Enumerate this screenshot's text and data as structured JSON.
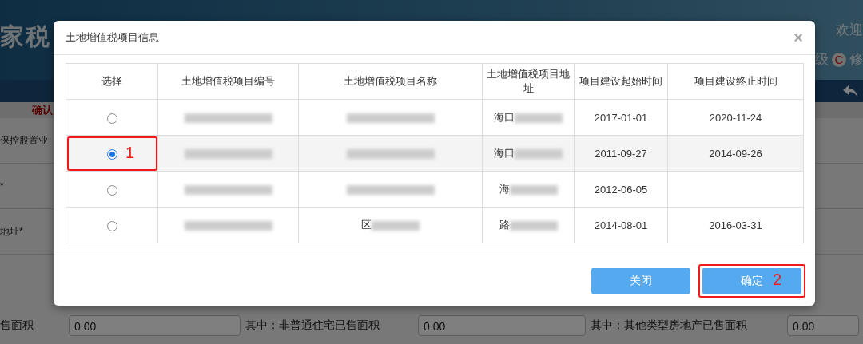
{
  "background": {
    "header_title": "家税",
    "welcome": "欢迎",
    "level_label": "级",
    "level_badge": "C",
    "header_link": "修",
    "confirm_label": "确认",
    "form_labels": [
      "保控股置业",
      "*",
      "地址*"
    ],
    "area_row": [
      {
        "kind": "label",
        "text": "售面积"
      },
      {
        "kind": "input",
        "value": "0.00"
      },
      {
        "kind": "label",
        "text": "其中：非普通住宅已售面积"
      },
      {
        "kind": "input",
        "value": "0.00"
      },
      {
        "kind": "label",
        "text": "其中：其他类型房地产已售面积"
      },
      {
        "kind": "input",
        "value": "0.00"
      }
    ]
  },
  "dialog": {
    "title": "土地增值税项目信息",
    "close": "×",
    "columns": [
      "选择",
      "土地增值税项目编号",
      "土地增值税项目名称",
      "土地增值税项目地址",
      "项目建设起始时间",
      "项目建设终止时间"
    ],
    "rows": [
      {
        "selected": false,
        "cells": [
          {
            "kind": "radio"
          },
          {
            "kind": "text",
            "redacted": true
          },
          {
            "kind": "text",
            "redacted": true
          },
          {
            "kind": "text",
            "text": "海口",
            "redacted": true
          },
          {
            "kind": "text",
            "text": "2017-01-01"
          },
          {
            "kind": "text",
            "text": "2020-11-24"
          }
        ]
      },
      {
        "selected": true,
        "annotation": "1",
        "cells": [
          {
            "kind": "radio"
          },
          {
            "kind": "text",
            "redacted": true
          },
          {
            "kind": "text",
            "redacted": true
          },
          {
            "kind": "text",
            "text": "海口",
            "redacted": true
          },
          {
            "kind": "text",
            "text": "2011-09-27"
          },
          {
            "kind": "text",
            "text": "2014-09-26"
          }
        ]
      },
      {
        "selected": false,
        "cells": [
          {
            "kind": "radio"
          },
          {
            "kind": "text",
            "redacted": true
          },
          {
            "kind": "text",
            "redacted": true
          },
          {
            "kind": "text",
            "text": "海",
            "redacted": true
          },
          {
            "kind": "text",
            "text": "2012-06-05"
          },
          {
            "kind": "text"
          }
        ]
      },
      {
        "selected": false,
        "cells": [
          {
            "kind": "radio"
          },
          {
            "kind": "text",
            "redacted": true
          },
          {
            "kind": "text",
            "text": "区",
            "redacted": true
          },
          {
            "kind": "text",
            "text": "路",
            "redacted": true
          },
          {
            "kind": "text",
            "text": "2014-08-01"
          },
          {
            "kind": "text",
            "text": "2016-03-31"
          }
        ]
      }
    ],
    "buttons": [
      {
        "label": "关闭"
      },
      {
        "label": "确定",
        "annotation": "2"
      }
    ]
  }
}
